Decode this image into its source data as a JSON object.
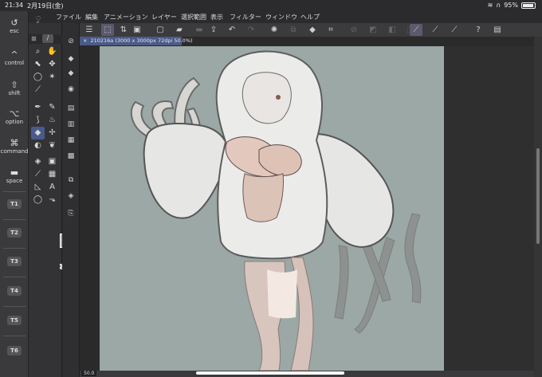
{
  "status": {
    "time": "21:34",
    "date": "2月19日(金)",
    "battery": "95%"
  },
  "modifiers": [
    {
      "glyph": "↺",
      "label": "esc"
    },
    {
      "glyph": "^",
      "label": "control"
    },
    {
      "glyph": "⇧",
      "label": "shift"
    },
    {
      "glyph": "⌥",
      "label": "option"
    },
    {
      "glyph": "⌘",
      "label": "command"
    },
    {
      "glyph": "▬",
      "label": "space"
    }
  ],
  "tkeys": [
    "T1",
    "T2",
    "T3",
    "T4",
    "T5",
    "T6"
  ],
  "menu": [
    "ファイル",
    "編集",
    "アニメーション",
    "レイヤー",
    "選択範囲",
    "表示",
    "フィルター",
    "ウィンドウ",
    "ヘルプ"
  ],
  "document": {
    "tab_label": "210216a (3000 x 3000px 72dpi 50.0%)",
    "close": "×"
  },
  "zoom": "50.0",
  "colors": {
    "main": "#b7a9a5",
    "sub": "#ffffff",
    "canvas_bg": "#9ba8a5",
    "accent": "#4a5a88"
  }
}
